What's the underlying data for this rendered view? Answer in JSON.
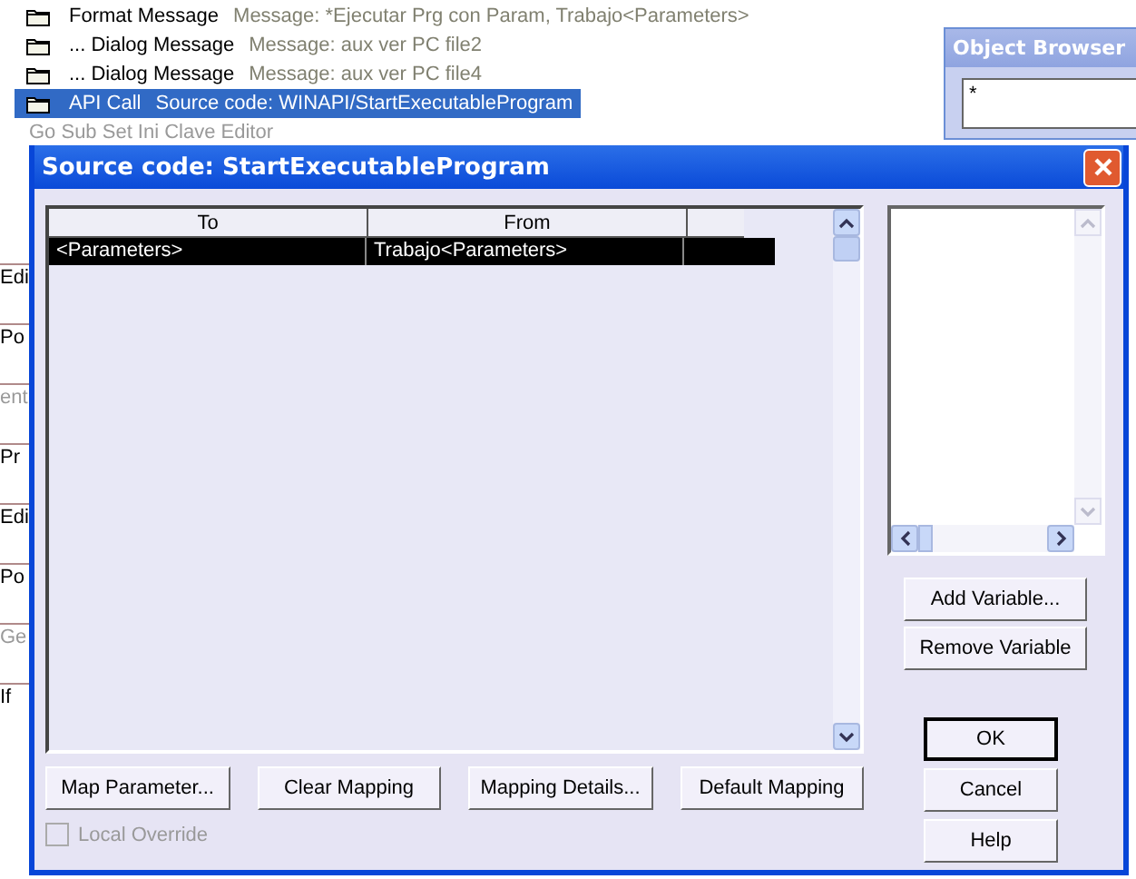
{
  "tree": [
    {
      "label": "Format Message",
      "detail": "Message: *Ejecutar Prg con Param, Trabajo<Parameters>",
      "selected": false
    },
    {
      "prefix": "...",
      "label": "Dialog Message",
      "detail": "Message: aux ver PC file2",
      "selected": false
    },
    {
      "prefix": "...",
      "label": "Dialog Message",
      "detail": "Message: aux ver PC file4",
      "selected": false
    },
    {
      "label": "API Call",
      "detail": "Source code: WINAPI/StartExecutableProgram",
      "selected": true
    }
  ],
  "covered_row": {
    "label": "Go Sub",
    "detail": "Set Ini Clave Editor"
  },
  "side_fragments": [
    {
      "text": "Edi",
      "disabled": false
    },
    {
      "text": "Po",
      "disabled": false
    },
    {
      "text": "ent",
      "disabled": true
    },
    {
      "text": "Pr",
      "disabled": false
    },
    {
      "text": "Edi",
      "disabled": false
    },
    {
      "text": "Po",
      "disabled": false
    },
    {
      "text": "Ge",
      "disabled": true
    },
    {
      "text": "If",
      "disabled": false
    }
  ],
  "object_browser": {
    "title": "Object Browser",
    "filter": "*"
  },
  "dialog": {
    "title": "Source code: StartExecutableProgram",
    "table": {
      "columns": [
        "To",
        "From"
      ],
      "rows": [
        {
          "cells": [
            "<Parameters>",
            "Trabajo<Parameters>"
          ],
          "selected": true
        }
      ]
    },
    "mapping_buttons": [
      "Map Parameter...",
      "Clear Mapping",
      "Mapping Details...",
      "Default Mapping"
    ],
    "local_override": {
      "label": "Local Override",
      "checked": false,
      "disabled": true
    },
    "variable_buttons": [
      "Add Variable...",
      "Remove Variable"
    ],
    "dialog_buttons": [
      {
        "label": "OK",
        "default": true
      },
      {
        "label": "Cancel",
        "default": false
      },
      {
        "label": "Help",
        "default": false
      }
    ]
  }
}
